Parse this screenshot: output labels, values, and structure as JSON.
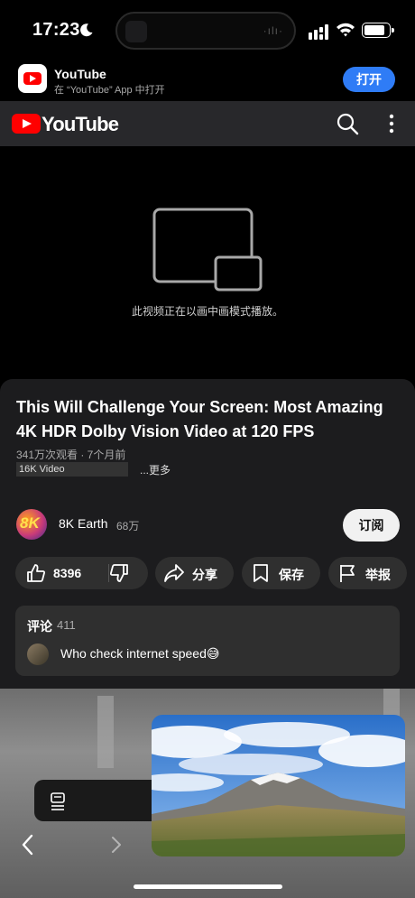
{
  "status_bar": {
    "time": "17:23"
  },
  "banner": {
    "app_name": "YouTube",
    "subtitle": "在 “YouTube” App 中打开",
    "open_label": "打开"
  },
  "header": {
    "logo_text": "YouTube"
  },
  "video": {
    "pip_message": "此视频正在以画中画模式播放。"
  },
  "info": {
    "title": "This Will Challenge Your Screen: Most Amazing 4K HDR Dolby Vision Video at 120 FPS",
    "meta": "341万次观看 · 7个月前",
    "tag": "16K Video",
    "more_label": "...更多"
  },
  "channel": {
    "name": "8K Earth",
    "subscribers": "68万",
    "avatar_text": "8K",
    "subscribe_label": "订阅"
  },
  "actions": {
    "likes": "8396",
    "share_label": "分享",
    "save_label": "保存",
    "report_label": "举报"
  },
  "comments": {
    "heading": "评论",
    "count": "411",
    "top_comment": "Who check internet speed😅"
  },
  "colors": {
    "brand_red": "#ff0000",
    "accent_blue": "#2f7cf6",
    "panel": "#1c1c1e"
  }
}
